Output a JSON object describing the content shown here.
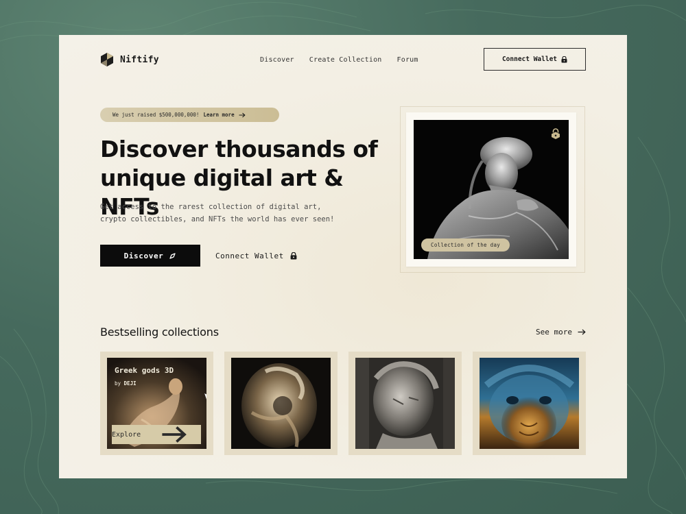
{
  "brand": {
    "name": "Niftify"
  },
  "nav": {
    "links": [
      "Discover",
      "Create Collection",
      "Forum"
    ],
    "connect_label": "Connect Wallet"
  },
  "hero": {
    "announcement": "We just raised $500,000,000!",
    "announcement_link": "Learn more",
    "title_line1": "Discover thousands of",
    "title_line2": "unique digital art & NFTs",
    "subtitle_line1": "Get access to the rarest collection of digital art,",
    "subtitle_line2": "crypto collectibles, and NFTs the world has ever seen!",
    "primary_label": "Discover",
    "secondary_label": "Connect Wallet"
  },
  "feature": {
    "badge": "Collection of the day"
  },
  "collections": {
    "title": "Bestselling collections",
    "see_more": "See more",
    "cards": [
      {
        "title": "Greek gods 3D",
        "by_prefix": "by",
        "author": "DEJI",
        "explore": "Explore"
      },
      {},
      {},
      {}
    ]
  },
  "colors": {
    "background": "#466a5d",
    "page": "#f3efe4",
    "accent_gold": "#cbbd95",
    "primary": "#0c0c0c"
  }
}
